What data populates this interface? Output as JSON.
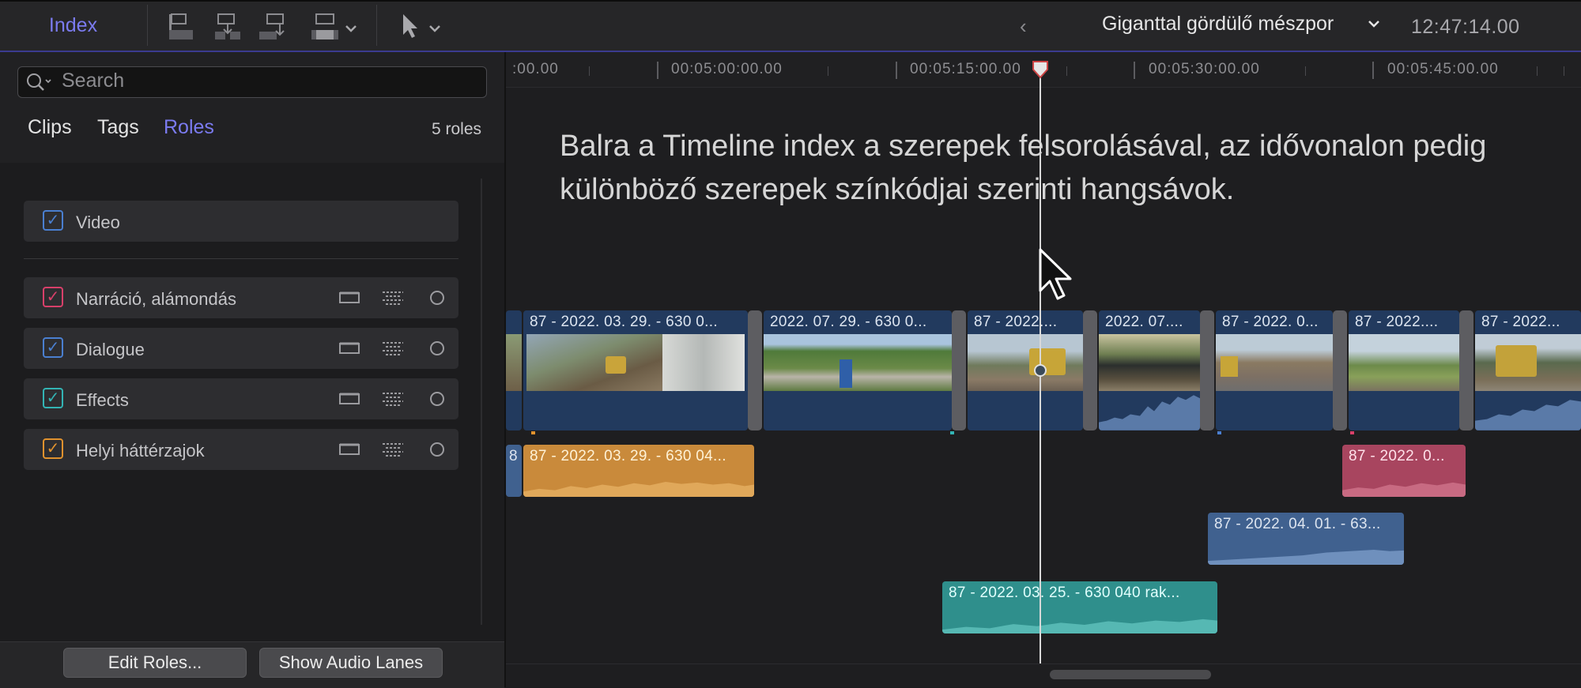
{
  "toolbar": {
    "index_label": "Index",
    "project_title": "Giganttal gördülő mészpor",
    "timecode": "12:47:14.00",
    "icons": [
      "connect-clip-icon",
      "insert-clip-icon",
      "append-clip-icon",
      "overwrite-clip-icon",
      "select-tool-icon"
    ]
  },
  "index": {
    "search_placeholder": "Search",
    "tabs": [
      "Clips",
      "Tags",
      "Roles"
    ],
    "active_tab": "Roles",
    "roles_count": "5 roles",
    "roles": [
      {
        "label": "Video",
        "color": "#4a7fd0",
        "checked": true
      },
      {
        "label": "Narráció, alámondás",
        "color": "#d8406a",
        "checked": true
      },
      {
        "label": "Dialogue",
        "color": "#4a7fd0",
        "checked": true
      },
      {
        "label": "Effects",
        "color": "#33b4b4",
        "checked": true
      },
      {
        "label": "Helyi háttérzajok",
        "color": "#e0922e",
        "checked": true
      }
    ],
    "edit_roles_button": "Edit Roles...",
    "show_audio_lanes_button": "Show Audio Lanes"
  },
  "timeline": {
    "ruler_labels": [
      ":00.00",
      "00:05:00:00.00",
      "00:05:15:00.00",
      "00:05:30:00.00",
      "00:05:45:00.00"
    ],
    "annotation": "Balra a Timeline index a szerepek felsorolásával, az idővonalon pedig különböző szerepek színkódjai szerinti hangsávok.",
    "storyline_clips": [
      "87 - 2022. 03. 29. - 630 0...",
      "2022. 07. 29. - 630 0...",
      "87 - 2022....",
      "2022. 07....",
      "87 - 2022. 0...",
      "87 - 2022....",
      "87 - 2022..."
    ],
    "audio_clips": [
      {
        "label": "87 - 2022. 03. 29. - 630 04...",
        "role": "Helyi háttérzajok",
        "color": "#c98a3b"
      },
      {
        "label": "87 - 2022. 0...",
        "role": "Narráció, alámondás",
        "color": "#a8455f"
      },
      {
        "label": "87 - 2022. 04. 01. - 63...",
        "role": "Dialogue",
        "color": "#40618f"
      },
      {
        "label": "87 - 2022. 03. 25. - 630 040 rak...",
        "role": "Effects",
        "color": "#2f8f8c"
      }
    ],
    "edge_stub_label": "8"
  }
}
